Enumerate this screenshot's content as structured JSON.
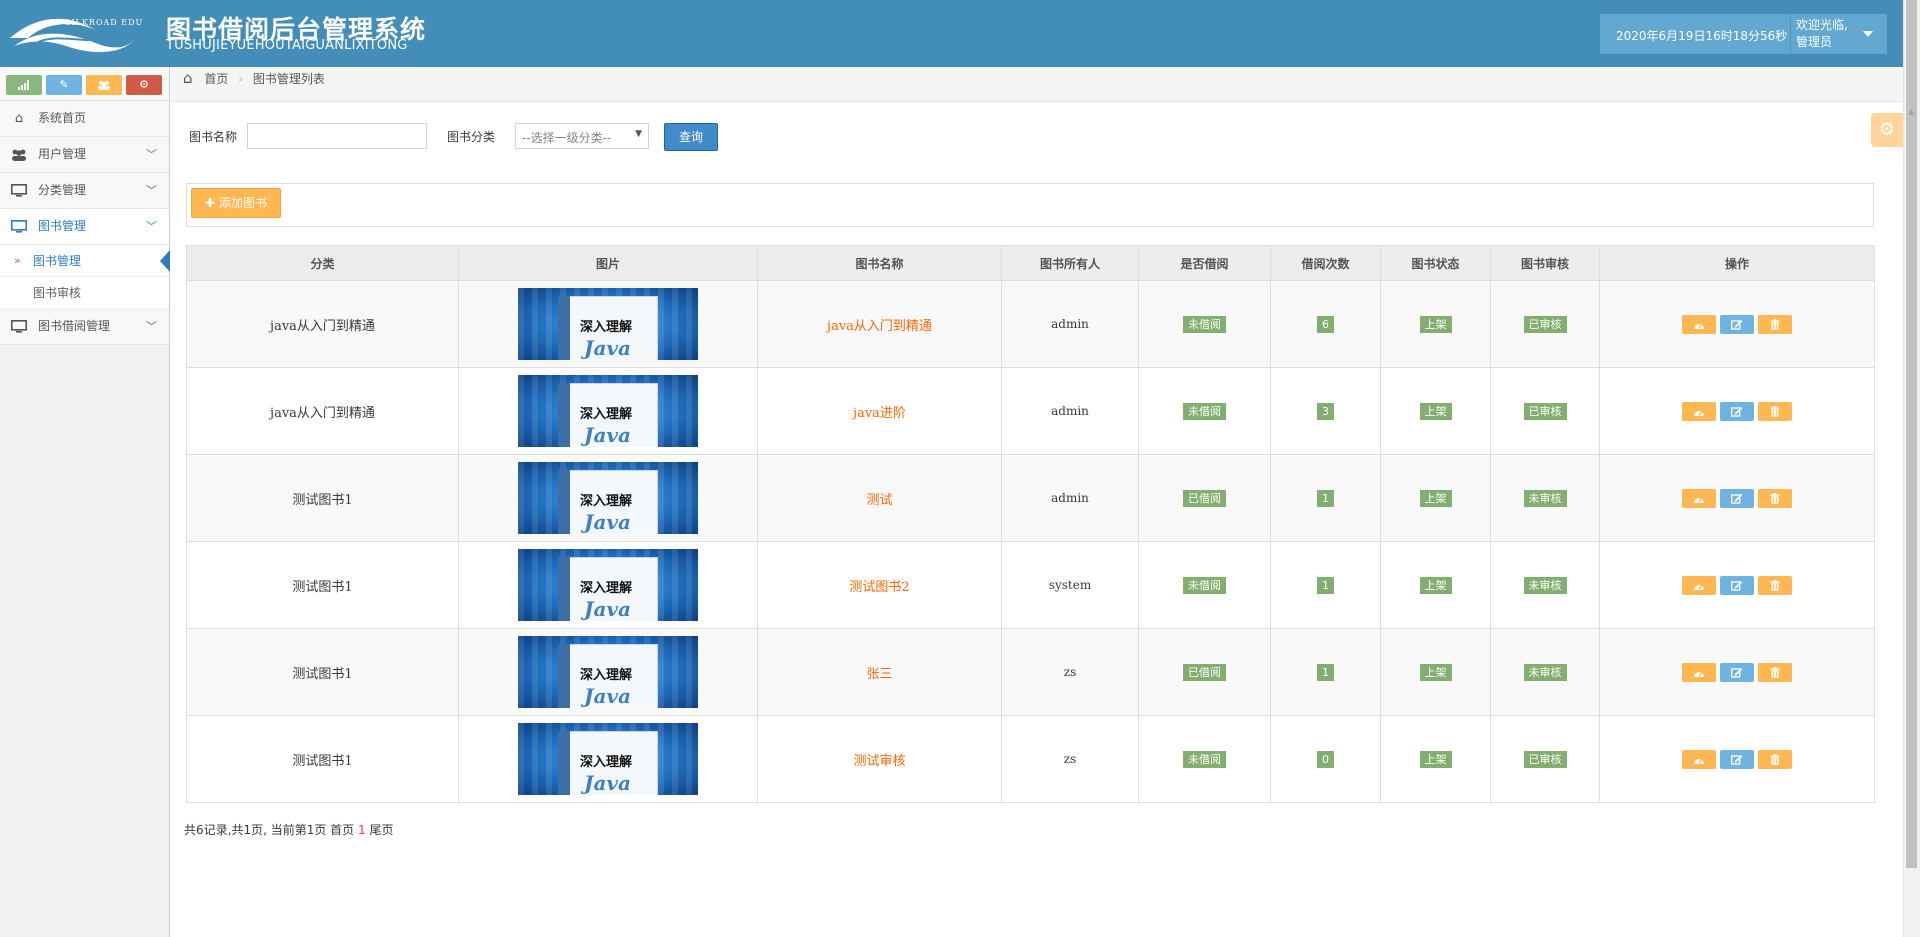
{
  "header": {
    "logo_text": "SILKROAD EDU",
    "title": "图书借阅后台管理系统",
    "subtitle": "TUSHUJIEYUEHOUTAIGUANLIXITONG",
    "datetime": "2020年6月19日16时18分56秒",
    "welcome": "欢迎光临,",
    "role": "管理员",
    "brand_color": "#438eb9"
  },
  "sidebar": {
    "shortcut_icons": [
      "signal-icon",
      "pencil-icon",
      "group-icon",
      "cogs-icon"
    ],
    "shortcut_colors": [
      "#87b87f",
      "#6fb3e0",
      "#ffb752",
      "#d15b47"
    ],
    "items": [
      {
        "label": "系统首页",
        "icon": "home-icon"
      },
      {
        "label": "用户管理",
        "icon": "users-icon"
      },
      {
        "label": "分类管理",
        "icon": "desktop-icon"
      },
      {
        "label": "图书管理",
        "icon": "desktop-icon"
      },
      {
        "label": "图书借阅管理",
        "icon": "desktop-icon"
      }
    ],
    "submenu": [
      {
        "label": "图书管理"
      },
      {
        "label": "图书审核"
      }
    ]
  },
  "breadcrumb": {
    "home": "首页",
    "current": "图书管理列表"
  },
  "search": {
    "name_label": "图书名称",
    "name_value": "",
    "category_label": "图书分类",
    "category_selected": "--选择一级分类--",
    "query_button": "查询"
  },
  "toolbar": {
    "add_button": "添加图书"
  },
  "table": {
    "headers": [
      "分类",
      "图片",
      "图书名称",
      "图书所有人",
      "是否借阅",
      "借阅次数",
      "图书状态",
      "图书审核",
      "操作"
    ],
    "book_cover_text": [
      "深入理解",
      "Java"
    ],
    "rows": [
      {
        "category": "java从入门到精通",
        "name": "java从入门到精通",
        "owner": "admin",
        "borrowed": "未借阅",
        "count": "6",
        "status": "上架",
        "review": "已审核"
      },
      {
        "category": "java从入门到精通",
        "name": "java进阶",
        "owner": "admin",
        "borrowed": "未借阅",
        "count": "3",
        "status": "上架",
        "review": "已审核"
      },
      {
        "category": "测试图书1",
        "name": "测试",
        "owner": "admin",
        "borrowed": "已借阅",
        "count": "1",
        "status": "上架",
        "review": "未审核"
      },
      {
        "category": "测试图书1",
        "name": "测试图书2",
        "owner": "system",
        "borrowed": "未借阅",
        "count": "1",
        "status": "上架",
        "review": "未审核"
      },
      {
        "category": "测试图书1",
        "name": "张三",
        "owner": "zs",
        "borrowed": "已借阅",
        "count": "1",
        "status": "上架",
        "review": "未审核"
      },
      {
        "category": "测试图书1",
        "name": "测试审核",
        "owner": "zs",
        "borrowed": "未借阅",
        "count": "0",
        "status": "上架",
        "review": "已审核"
      }
    ]
  },
  "pager": {
    "summary": "共6记录,共1页, 当前第1页 首页",
    "current_page": "1",
    "last": "尾页"
  }
}
